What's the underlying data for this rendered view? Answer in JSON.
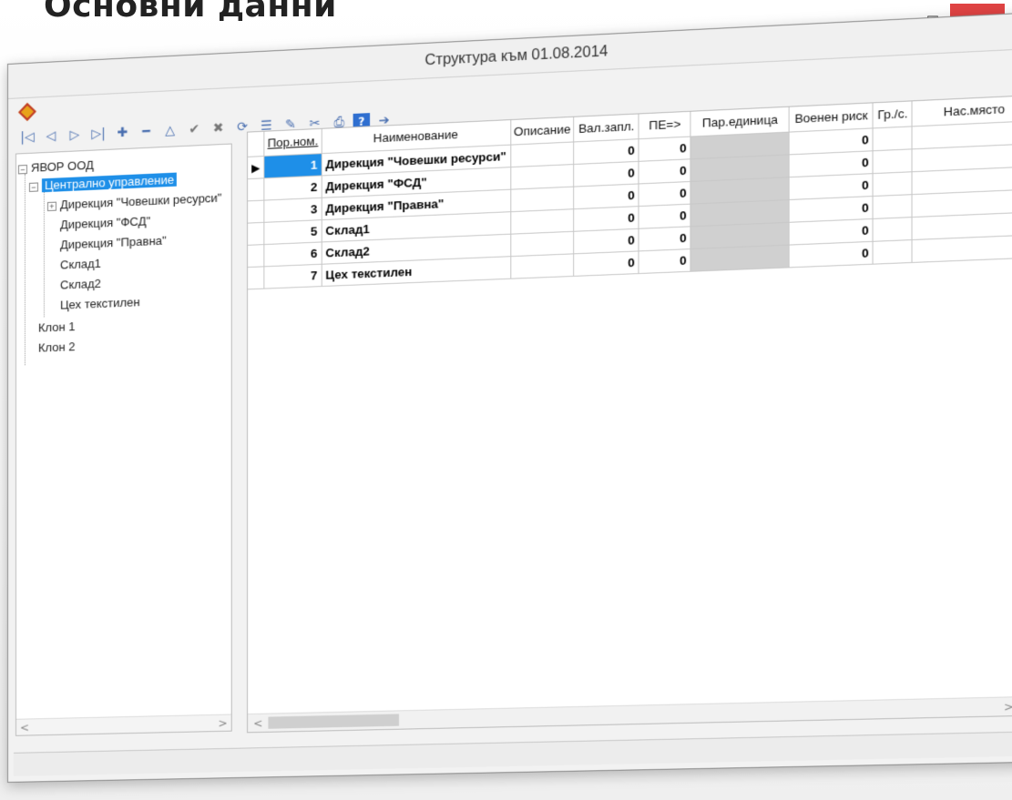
{
  "heading": "Основни данни",
  "window": {
    "title": "Структура към 01.08.2014",
    "controls": {
      "minimize": "–",
      "maximize": "☐",
      "close": "✕"
    }
  },
  "toolbar": {
    "buttons": [
      {
        "name": "first-record",
        "glyph": "|◁"
      },
      {
        "name": "prev-record",
        "glyph": "◁"
      },
      {
        "name": "next-record",
        "glyph": "▷"
      },
      {
        "name": "last-record",
        "glyph": "▷|"
      },
      {
        "name": "insert",
        "glyph": "✚"
      },
      {
        "name": "delete",
        "glyph": "━"
      },
      {
        "name": "edit",
        "glyph": "△"
      },
      {
        "name": "post",
        "glyph": "✔"
      },
      {
        "name": "cancel",
        "glyph": "✖"
      },
      {
        "name": "refresh",
        "glyph": "⟳"
      },
      {
        "name": "list",
        "glyph": "☰"
      },
      {
        "name": "filter",
        "glyph": "✎"
      },
      {
        "name": "tools",
        "glyph": "✂"
      },
      {
        "name": "print",
        "glyph": "⎙"
      },
      {
        "name": "help",
        "glyph": "?"
      },
      {
        "name": "export",
        "glyph": "➔"
      }
    ]
  },
  "tree": {
    "root": "ЯВОР ООД",
    "central": "Централно управление",
    "children": [
      "Дирекция \"Човешки ресурси\"",
      "Дирекция \"ФСД\"",
      "Дирекция \"Правна\"",
      "Склад1",
      "Склад2",
      "Цех текстилен"
    ],
    "branches": [
      "Клон 1",
      "Клон 2"
    ]
  },
  "grid": {
    "columns": [
      "Пор.ном.",
      "Наименование",
      "Описание",
      "Вал.запл.",
      "ПЕ=>",
      "Пар.единица",
      "Военен риск",
      "Гр./с.",
      "Нас.място"
    ],
    "rows": [
      {
        "num": "1",
        "name": "Дирекция \"Човешки ресурси\"",
        "val": "0",
        "pe": "0",
        "risk": "0"
      },
      {
        "num": "2",
        "name": "Дирекция \"ФСД\"",
        "val": "0",
        "pe": "0",
        "risk": "0"
      },
      {
        "num": "3",
        "name": "Дирекция \"Правна\"",
        "val": "0",
        "pe": "0",
        "risk": "0"
      },
      {
        "num": "5",
        "name": "Склад1",
        "val": "0",
        "pe": "0",
        "risk": "0"
      },
      {
        "num": "6",
        "name": "Склад2",
        "val": "0",
        "pe": "0",
        "risk": "0"
      },
      {
        "num": "7",
        "name": "Цех текстилен",
        "val": "0",
        "pe": "0",
        "risk": "0"
      }
    ]
  }
}
